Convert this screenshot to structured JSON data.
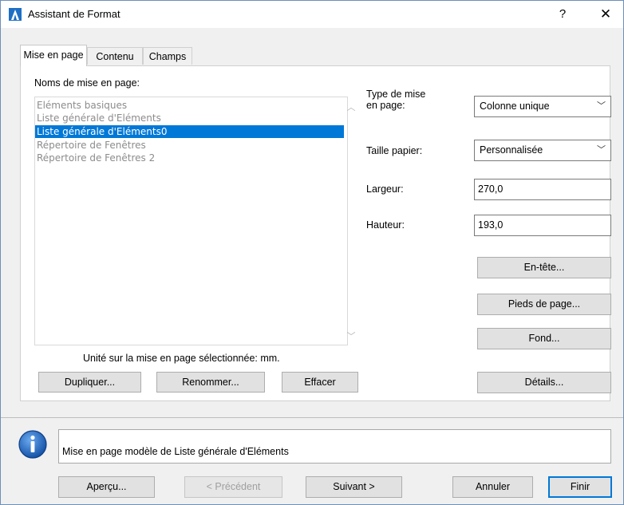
{
  "window": {
    "title": "Assistant de Format",
    "help_glyph": "?",
    "close_glyph": "✕"
  },
  "tabs": [
    {
      "label": "Mise en page",
      "active": true
    },
    {
      "label": "Contenu",
      "active": false
    },
    {
      "label": "Champs",
      "active": false
    }
  ],
  "layouts": {
    "heading": "Noms de mise en page:",
    "items": [
      {
        "label": "Eléments basiques",
        "selected": false
      },
      {
        "label": "Liste générale d'Eléments",
        "selected": false
      },
      {
        "label": "Liste générale d'Eléments0",
        "selected": true
      },
      {
        "label": "Répertoire de Fenêtres",
        "selected": false
      },
      {
        "label": "Répertoire de Fenêtres 2",
        "selected": false
      }
    ],
    "unit_note": "Unité sur la mise en page sélectionnée: mm.",
    "duplicate_label": "Dupliquer...",
    "rename_label": "Renommer...",
    "delete_label": "Effacer"
  },
  "settings": {
    "type_label": "Type de mise\nen page:",
    "type_value": "Colonne unique",
    "paper_label": "Taille papier:",
    "paper_value": "Personnalisée",
    "width_label": "Largeur:",
    "width_value": "270,0",
    "height_label": "Hauteur:",
    "height_value": "193,0",
    "header_button": "En-tête...",
    "footer_button": "Pieds de page...",
    "background_button": "Fond...",
    "details_button": "Détails..."
  },
  "info": {
    "text": "Mise en page modèle de Liste générale d'Eléments"
  },
  "footer": {
    "preview_label": "Aperçu...",
    "previous_label": "< Précédent",
    "next_label": "Suivant >",
    "cancel_label": "Annuler",
    "finish_label": "Finir"
  },
  "colors": {
    "selection": "#0078d7",
    "disabled_text": "#8c8c8c"
  }
}
